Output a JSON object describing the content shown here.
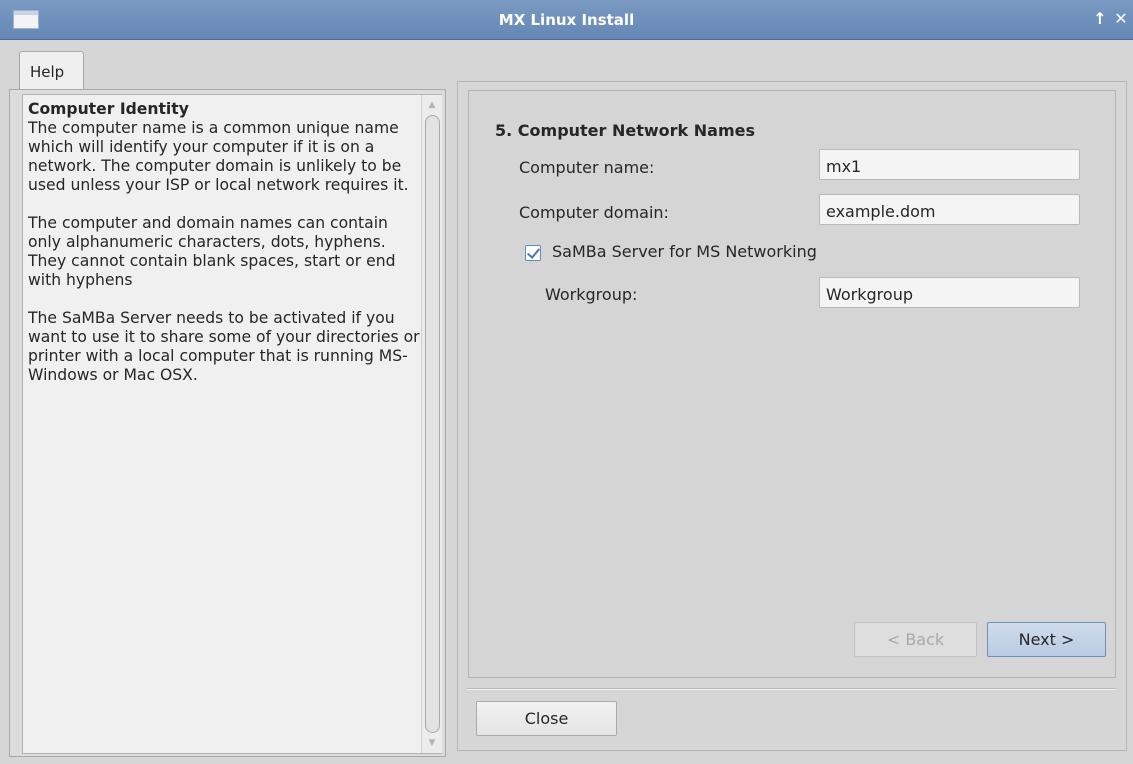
{
  "window": {
    "title": "MX Linux Install",
    "controls": {
      "maximize": "↑",
      "close": "✕"
    }
  },
  "help": {
    "tab_label": "Help",
    "heading": "Computer Identity",
    "paragraphs": [
      "The computer name is a common unique name which will identify your computer if it is on a network. The computer domain is unlikely to be used unless your ISP or local network requires it.",
      "The computer and domain names can contain only alphanumeric characters, dots, hyphens. They cannot contain blank spaces, start or end with hyphens",
      "The SaMBa Server needs to be activated if you want to use it to share some of your directories or printer with a local computer that is running MS-Windows or Mac OSX."
    ],
    "scroll_up_icon": "▲",
    "scroll_down_icon": "▼"
  },
  "step": {
    "title": "5. Computer Network Names",
    "computer_name_label": "Computer name:",
    "computer_name_value": "mx1",
    "computer_domain_label": "Computer domain:",
    "computer_domain_value": "example.dom",
    "samba_label": "SaMBa Server for MS Networking",
    "samba_checked": true,
    "workgroup_label": "Workgroup:",
    "workgroup_value": "Workgroup"
  },
  "buttons": {
    "back": "< Back",
    "next": "Next >",
    "close": "Close"
  },
  "colors": {
    "titlebar": "#6f90bc",
    "accent": "#5f8bc1"
  }
}
